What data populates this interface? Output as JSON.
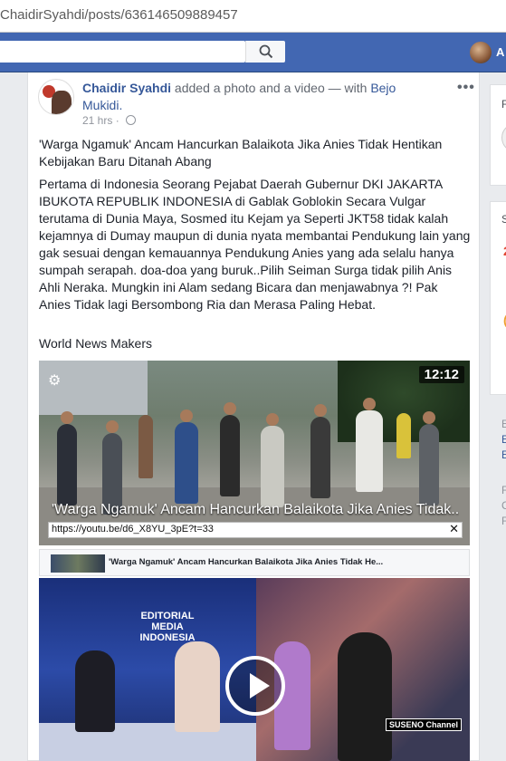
{
  "browser": {
    "url": "ChaidirSyahdi/posts/636146509889457"
  },
  "topnav": {
    "search_placeholder": "",
    "user_name_fragment": "A"
  },
  "post": {
    "author": "Chaidir Syahdi",
    "action_text": " added a photo and a video — with ",
    "tagged": "Bejo Mukidi.",
    "time": "21 hrs",
    "more_label": "•••",
    "title_text": "'Warga Ngamuk' Ancam Hancurkan Balaikota Jika Anies Tidak Hentikan Kebijakan Baru Ditanah Abang",
    "body_text": "Pertama di Indonesia Seorang Pejabat Daerah Gubernur DKI JAKARTA IBUKOTA REPUBLIK INDONESIA di Gablak Goblokin Secara Vulgar terutama di Dunia Maya, Sosmed itu Kejam ya Seperti JKT58 tidak kalah kejamnya di Dumay maupun di dunia nyata membantai Pendukung lain yang gak sesuai dengan kemauannya Pendukung Anies yang ada selalu hanya sumpah serapah. doa-doa yang buruk..Pilih Seiman Surga tidak pilih Anis Ahli Neraka. Mungkin ini Alam sedang Bicara dan menjawabnya ?! Pak Anies Tidak lagi Bersombong Ria dan Merasa Paling Hebat.",
    "source_text": "World News Makers",
    "video": {
      "duration": "12:12",
      "title": "'Warga Ngamuk' Ancam Hancurkan Balaikota Jika Anies Tidak...",
      "share_url": "https://youtu.be/d6_X8YU_3pE?t=33",
      "close_label": "✕",
      "gear_label": "⚙"
    },
    "link_preview": {
      "title": "'Warga Ngamuk' Ancam Hancurkan Balaikota Jika Anies Tidak He..."
    },
    "video2": {
      "logo_text": "EDITORIAL MEDIA INDONESIA",
      "badge": "SUSENO Channel"
    }
  },
  "right_sidebar": {
    "box1_letter": "F",
    "box2_letter": "S",
    "icon1": "2",
    "icon2": "(",
    "footer_lines": [
      "E",
      "E",
      "E"
    ],
    "footer_lines2": [
      "F",
      "C",
      "F"
    ]
  },
  "colors": {
    "fb_blue": "#4267b2",
    "link": "#365899",
    "background": "#e9ebee"
  }
}
